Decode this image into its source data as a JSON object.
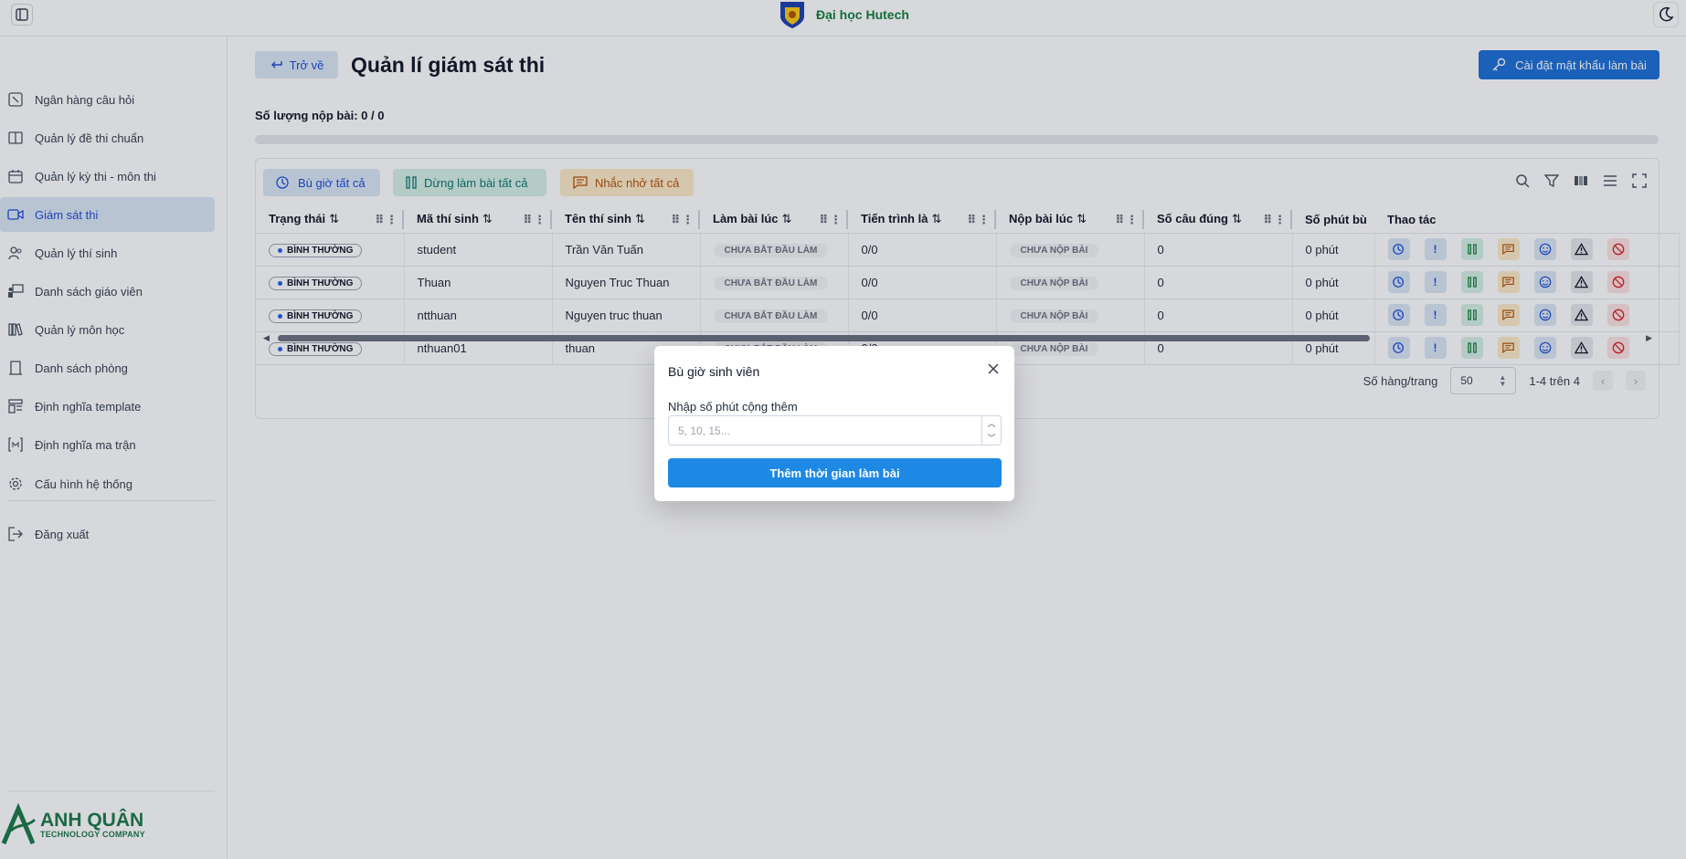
{
  "header": {
    "brand_name": "Đại học Hutech",
    "sidebar_toggle_icon": "sidebar-toggle-icon",
    "theme_icon": "moon-icon"
  },
  "sidebar": {
    "items": [
      {
        "label": "Ngân hàng câu hỏi",
        "icon": "question-bank-icon",
        "active": false
      },
      {
        "label": "Quản lý đề thi chuẩn",
        "icon": "book-icon",
        "active": false
      },
      {
        "label": "Quản lý kỳ thi - môn thi",
        "icon": "calendar-icon",
        "active": false
      },
      {
        "label": "Giám sát thi",
        "icon": "video-icon",
        "active": true
      },
      {
        "label": "Quản lý thí sinh",
        "icon": "users-icon",
        "active": false
      },
      {
        "label": "Danh sách giáo viên",
        "icon": "teacher-icon",
        "active": false
      },
      {
        "label": "Quản lý môn học",
        "icon": "library-icon",
        "active": false
      },
      {
        "label": "Danh sách phòng",
        "icon": "door-icon",
        "active": false
      },
      {
        "label": "Định nghĩa template",
        "icon": "template-icon",
        "active": false
      },
      {
        "label": "Định nghĩa ma trận",
        "icon": "matrix-icon",
        "active": false
      },
      {
        "label": "Cấu hình hệ thống",
        "icon": "gear-icon",
        "active": false
      }
    ],
    "logout_label": "Đăng xuất",
    "company_name": "ANH QUÂN",
    "company_sub": "TECHNOLOGY COMPANY"
  },
  "main": {
    "back_label": "Trở về",
    "page_title": "Quản lí giám sát thi",
    "password_button_label": "Cài đặt mật khẩu làm bài",
    "submit_count": "Số lượng nộp bài: 0 / 0",
    "toolbar": {
      "add_time_all": "Bù giờ tất cả",
      "stop_all": "Dừng làm bài tất cả",
      "remind_all": "Nhắc nhở tất cả"
    },
    "columns": [
      "Trạng thái",
      "Mã thí sinh",
      "Tên thí sinh",
      "Làm bài lúc",
      "Tiến trình là",
      "Nộp bài lúc",
      "Số câu đúng",
      "Số phút bù",
      "Thao tác"
    ],
    "rows": [
      {
        "status": "BÌNH THƯỜNG",
        "code": "student",
        "name": "Trần Văn Tuấn",
        "start": "CHƯA BẮT ĐẦU LÀM",
        "progress": "0/0",
        "submit": "CHƯA NỘP BÀI",
        "correct": "0",
        "extra": "0 phút"
      },
      {
        "status": "BÌNH THƯỜNG",
        "code": "Thuan",
        "name": "Nguyen Truc Thuan",
        "start": "CHƯA BẮT ĐẦU LÀM",
        "progress": "0/0",
        "submit": "CHƯA NỘP BÀI",
        "correct": "0",
        "extra": "0 phút"
      },
      {
        "status": "BÌNH THƯỜNG",
        "code": "ntthuan",
        "name": "Nguyen truc thuan",
        "start": "CHƯA BẮT ĐẦU LÀM",
        "progress": "0/0",
        "submit": "CHƯA NỘP BÀI",
        "correct": "0",
        "extra": "0 phút"
      },
      {
        "status": "BÌNH THƯỜNG",
        "code": "nthuan01",
        "name": "thuan",
        "start": "CHƯA BẮT ĐẦU LÀM",
        "progress": "0/0",
        "submit": "CHƯA NỘP BÀI",
        "correct": "0",
        "extra": "0 phút"
      }
    ],
    "pagination": {
      "rows_per_page_label": "Số hàng/trang",
      "rows_per_page_value": "50",
      "range": "1-4 trên 4"
    }
  },
  "modal": {
    "title": "Bù giờ sinh viên",
    "field_label": "Nhập số phút cộng thêm",
    "field_placeholder": "5, 10, 15...",
    "field_value": "",
    "submit_label": "Thêm thời gian làm bài"
  },
  "colors": {
    "primary": "#1d6fd6",
    "modal_button": "#1e88e5",
    "active_nav_bg": "#dbe7f6",
    "brand_green": "#15803d"
  }
}
